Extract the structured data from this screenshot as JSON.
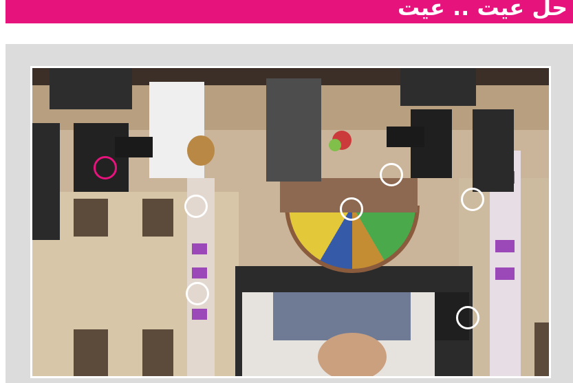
{
  "header": {
    "title": "حل عيت .. عيت"
  },
  "colors": {
    "accent": "#e6137d",
    "panel": "#dcdcdc",
    "marker": "#ffffff"
  },
  "puzzle": {
    "image_description_icon": "stage-photo-icon",
    "markers": [
      {
        "id": 1,
        "active": true
      },
      {
        "id": 2
      },
      {
        "id": 3
      },
      {
        "id": 4
      },
      {
        "id": 5
      },
      {
        "id": 6
      },
      {
        "id": 7
      }
    ]
  }
}
